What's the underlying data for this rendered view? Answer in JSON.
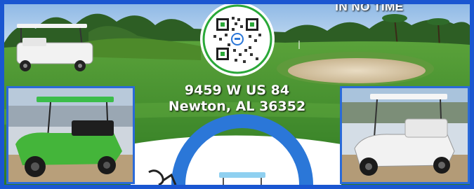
{
  "promo": {
    "headline": "IN NO TIME",
    "address_line1": "9459 W US 84",
    "address_line2": "Newton, AL 36352"
  },
  "colors": {
    "frame_blue": "#1a56d1",
    "grass_green": "#3f8a2c",
    "sky_blue": "#9fc4ea",
    "qr_green": "#2aa838",
    "logo_blue": "#2b77d8"
  },
  "icons": {
    "qr_code": "qr-code-icon",
    "logo": "golf-cart-logo-icon"
  }
}
